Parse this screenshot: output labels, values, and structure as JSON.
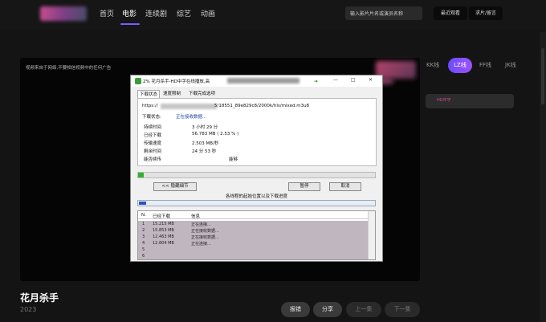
{
  "nav": {
    "items": [
      "首页",
      "电影",
      "连续剧",
      "综艺",
      "动画"
    ],
    "active_index": 1,
    "search_placeholder": "输入影片片名或演员名称",
    "history_label": "最近观看",
    "request_label": "求片/留言"
  },
  "player": {
    "notice": "视频来自于网络,不要相信视频中的任何广告"
  },
  "right_panel": {
    "lines": [
      "KK线",
      "LZ线",
      "FF线",
      "JK线"
    ],
    "active_line": 1,
    "card_text": "HD中字"
  },
  "movie": {
    "title": "花月杀手",
    "year": "2023",
    "actions": [
      "报错",
      "分享",
      "上一集",
      "下一集"
    ]
  },
  "dialog": {
    "title": "2% 花月杀手-HD中字在线播放,高",
    "controls": [
      "—",
      "□",
      "✕"
    ],
    "tabs": [
      "下载状态",
      "速度限制",
      "下载完成选项"
    ],
    "url_prefix": "https://",
    "url_suffix": "5/18551_89e829c8/2000k/hls/mixed.m3u8",
    "status_label": "下载状态:",
    "status_value": "正在接收数据...",
    "fields": [
      {
        "key": "持续时间",
        "value": "3 小时 29 分"
      },
      {
        "key": "已经下载",
        "value": "56.783  MB  ( 2.53 % )"
      },
      {
        "key": "传输速度",
        "value": "2.503  MB/秒"
      },
      {
        "key": "剩余时间",
        "value": "24 分 53 秒"
      },
      {
        "key": "能否续传",
        "value": "能够"
      }
    ],
    "progress_percent": 2.53,
    "buttons": {
      "hide": "<< 隐藏细节",
      "pause": "暂停",
      "cancel": "取消"
    },
    "caption": "各线程的起始位置以及下载进度",
    "segment_percent": 3,
    "table": {
      "headers": [
        "N.",
        "已经下载",
        "信息"
      ],
      "rows": [
        {
          "n": "1",
          "downloaded": "15.215  MB",
          "info": "正在连接..."
        },
        {
          "n": "2",
          "downloaded": "15.853  MB",
          "info": "正在接收数据..."
        },
        {
          "n": "3",
          "downloaded": "12.463  MB",
          "info": "正在接收数据..."
        },
        {
          "n": "4",
          "downloaded": "12.804  MB",
          "info": "正在连接..."
        },
        {
          "n": "5",
          "downloaded": "",
          "info": ""
        },
        {
          "n": "6",
          "downloaded": "",
          "info": ""
        }
      ]
    }
  },
  "colors": {
    "accent": "#7a5cff",
    "background": "#141414",
    "progress_green": "#2fb22f",
    "list_row": "#c0b6c0"
  }
}
